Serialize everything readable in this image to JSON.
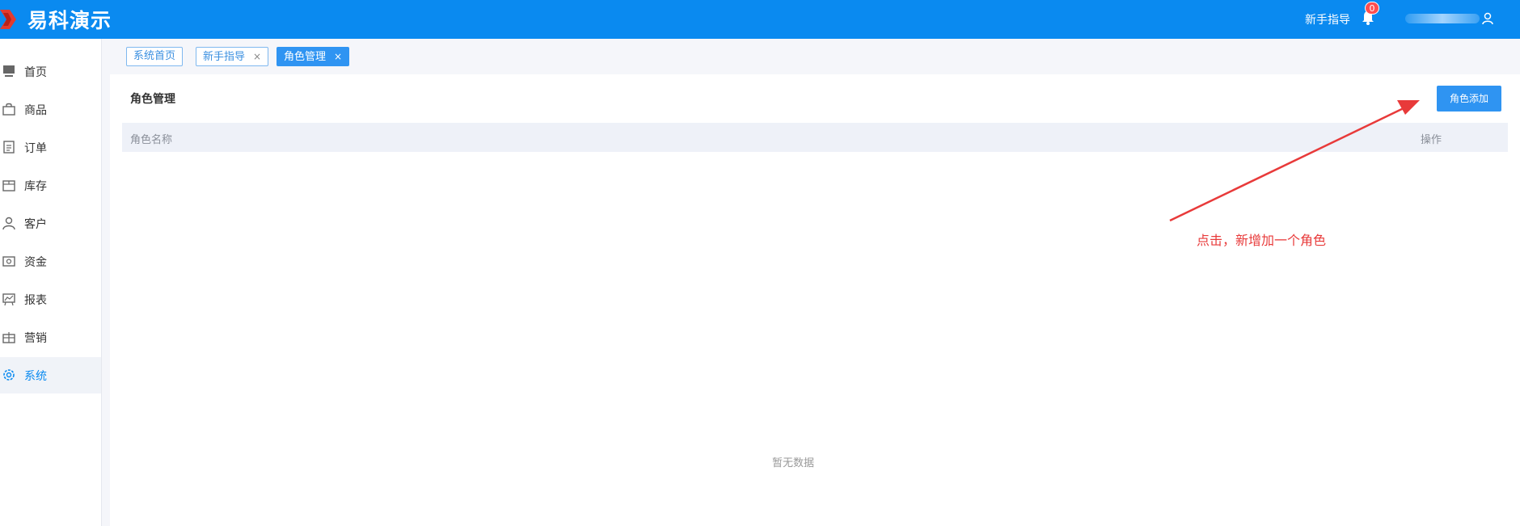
{
  "header": {
    "logo_text": "易科演示",
    "guide_link": "新手指导",
    "notification_count": "0",
    "brand_color": "#0a8af0"
  },
  "sidebar": {
    "items": [
      {
        "label": "首页",
        "icon": "monitor-icon"
      },
      {
        "label": "商品",
        "icon": "shopping-bag-icon"
      },
      {
        "label": "订单",
        "icon": "document-icon"
      },
      {
        "label": "库存",
        "icon": "package-icon"
      },
      {
        "label": "客户",
        "icon": "user-icon"
      },
      {
        "label": "资金",
        "icon": "cash-icon"
      },
      {
        "label": "报表",
        "icon": "chart-icon"
      },
      {
        "label": "营销",
        "icon": "gift-icon"
      },
      {
        "label": "系统",
        "icon": "gear-icon",
        "active": true
      }
    ]
  },
  "tabs": [
    {
      "label": "系统首页"
    },
    {
      "label": "新手指导",
      "close": "×"
    },
    {
      "label": "角色管理",
      "close": "×",
      "active": true
    }
  ],
  "page": {
    "title": "角色管理",
    "add_button": "角色添加",
    "table": {
      "columns": [
        "角色名称",
        "操作"
      ],
      "empty_text": "暂无数据"
    }
  },
  "annotation": {
    "text": "点击，新增加一个角色",
    "color": "#e83a3a"
  }
}
